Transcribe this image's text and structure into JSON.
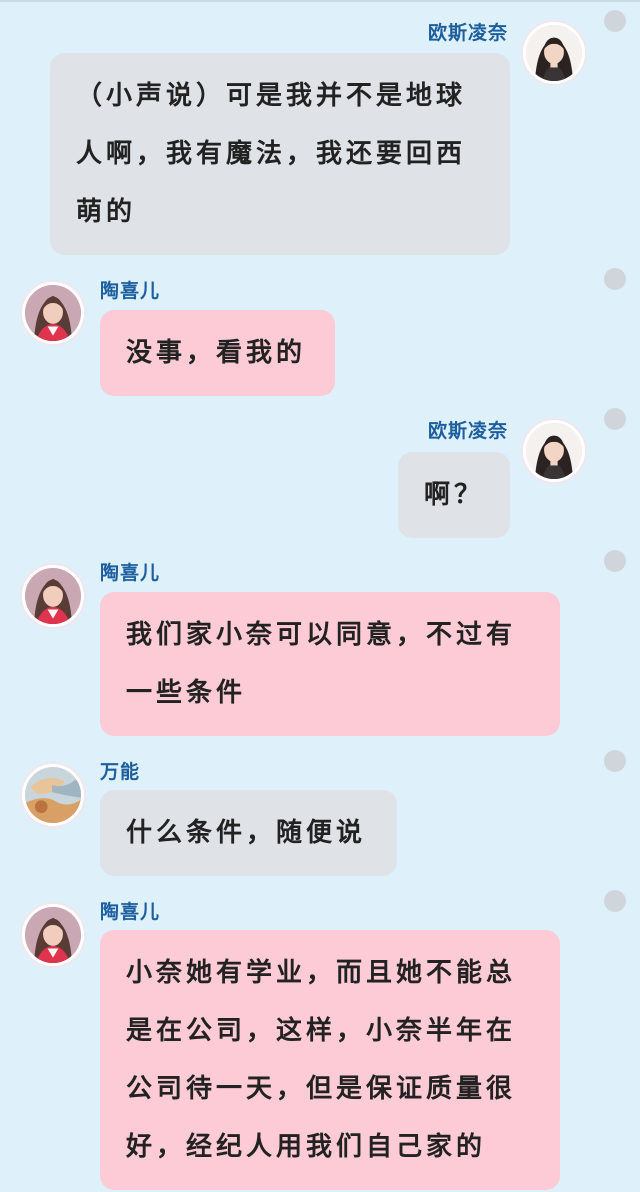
{
  "messages": [
    {
      "sender": "欧斯凌奈",
      "side": "right",
      "bubble": "gray",
      "avatar": "ousi-avatar",
      "lines": [
        "（小声说）可是我并不是地球",
        "人啊，我有魔法，我还要回西",
        "萌的"
      ]
    },
    {
      "sender": "陶喜儿",
      "side": "left",
      "bubble": "pink",
      "avatar": "taoxier-avatar",
      "lines": [
        "没事，看我的"
      ]
    },
    {
      "sender": "欧斯凌奈",
      "side": "right",
      "bubble": "gray",
      "avatar": "ousi-avatar",
      "lines": [
        "啊？"
      ]
    },
    {
      "sender": "陶喜儿",
      "side": "left",
      "bubble": "pink",
      "avatar": "taoxier-avatar",
      "lines": [
        "我们家小奈可以同意，不过有",
        "一些条件"
      ]
    },
    {
      "sender": "万能",
      "side": "left",
      "bubble": "gray",
      "avatar": "wanneng-avatar",
      "lines": [
        "什么条件，随便说"
      ]
    },
    {
      "sender": "陶喜儿",
      "side": "left",
      "bubble": "pink",
      "avatar": "taoxier-avatar",
      "lines": [
        "小奈她有学业，而且她不能总",
        "是在公司，这样，小奈半年在",
        "公司待一天，但是保证质量很",
        "好，经纪人用我们自己家的"
      ]
    }
  ],
  "colors": {
    "background": "#def1fb",
    "gray_bubble": "#dfe3e8",
    "pink_bubble": "#fccbd6",
    "name": "#1c5e9e",
    "dot": "#cfd5da"
  }
}
